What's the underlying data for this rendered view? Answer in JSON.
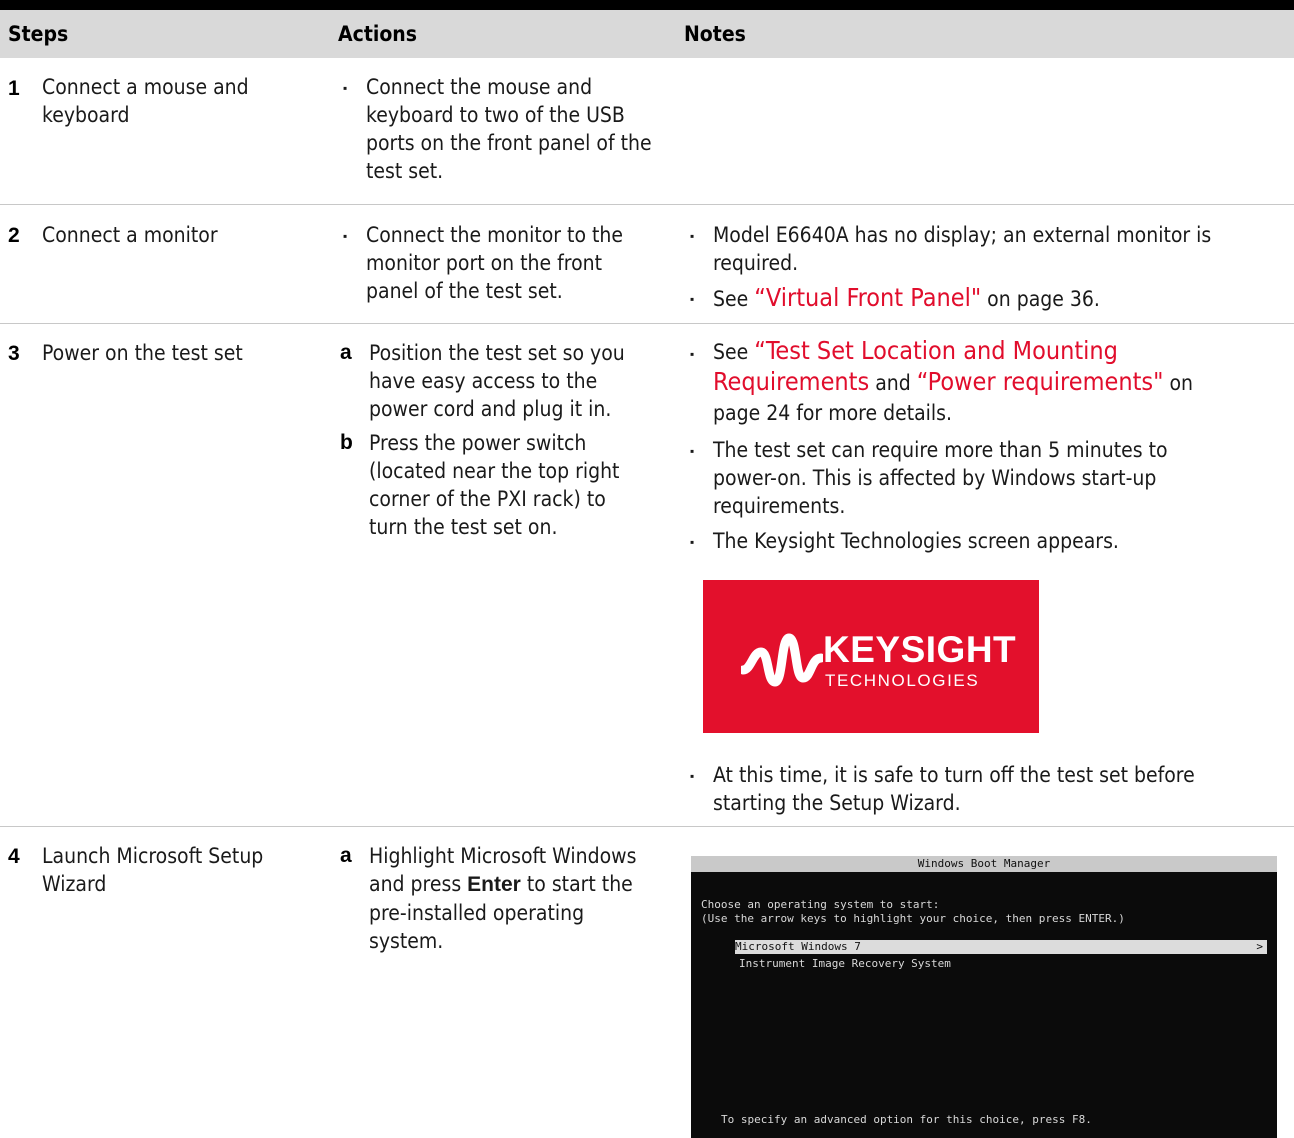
{
  "table": {
    "headers": [
      "Steps",
      "Actions",
      "Notes"
    ],
    "rows": [
      {
        "num": "1",
        "step": [
          "Connect a mouse and",
          "keyboard"
        ],
        "actions": [
          {
            "marker": "▪",
            "lines": [
              "Connect the mouse and",
              "keyboard to two of the USB",
              "ports on the front panel of the",
              "test set."
            ]
          }
        ],
        "notes": []
      },
      {
        "num": "2",
        "step": [
          "Connect a monitor"
        ],
        "actions": [
          {
            "marker": "▪",
            "lines": [
              "Connect the monitor to the",
              "monitor port on the front",
              "panel of the test set."
            ]
          }
        ],
        "notes": [
          {
            "lines": [
              "Model E6640A has no display; an external monitor is",
              "required."
            ]
          },
          {
            "prefix": "See ",
            "link": "“Virtual Front Panel\"",
            "suffix": " on page 36."
          }
        ]
      },
      {
        "num": "3",
        "step": [
          "Power on the test set"
        ],
        "actions": [
          {
            "marker": "a",
            "lines": [
              "Position the test set so you",
              "have easy access to the",
              "power cord and plug it in."
            ]
          },
          {
            "marker": "b",
            "lines": [
              "Press the power switch",
              "(located near the top right",
              "corner of the PXI rack) to",
              "turn the test set on."
            ]
          }
        ],
        "notes": [
          {
            "prefix": "See ",
            "link1": "“Test Set Location and Mounting",
            "link1b": "Requirements",
            "mid": " and ",
            "link2": "“Power requirements\"",
            "suffix": " on",
            "tail": "page 24 for more details."
          },
          {
            "lines": [
              "The test set can require more than 5 minutes to",
              "power-on. This is affected by Windows start-up",
              "requirements."
            ]
          },
          {
            "lines": [
              "The Keysight Technologies screen appears."
            ]
          },
          {
            "lines": [
              "At this time, it is safe to turn off the test set before",
              "starting the Setup Wizard."
            ]
          }
        ]
      },
      {
        "num": "4",
        "step": [
          "Launch Microsoft Setup",
          "Wizard"
        ],
        "actions": [
          {
            "marker": "a",
            "line1": "Highlight Microsoft Windows",
            "pre": "and press ",
            "bold": "Enter",
            "post": " to start the",
            "lines": [
              "pre-installed operating",
              "system."
            ]
          }
        ],
        "notes": []
      }
    ]
  },
  "logo": {
    "word1": "KEYSIGHT",
    "word2": "TECHNOLOGIES",
    "bg": "#e3102c"
  },
  "boot_screen": {
    "title": "Windows Boot Manager",
    "prompt": "Choose an operating system to start:",
    "hint": "(Use the arrow keys to highlight your choice, then press ENTER.)",
    "options": [
      "Microsoft Windows 7",
      "Instrument Image Recovery System"
    ],
    "selected_marker": ">",
    "footer": "To specify an advanced option for this choice, press F8."
  },
  "colors": {
    "link": "#e10d2c",
    "header_bg": "#d9d9d9"
  }
}
